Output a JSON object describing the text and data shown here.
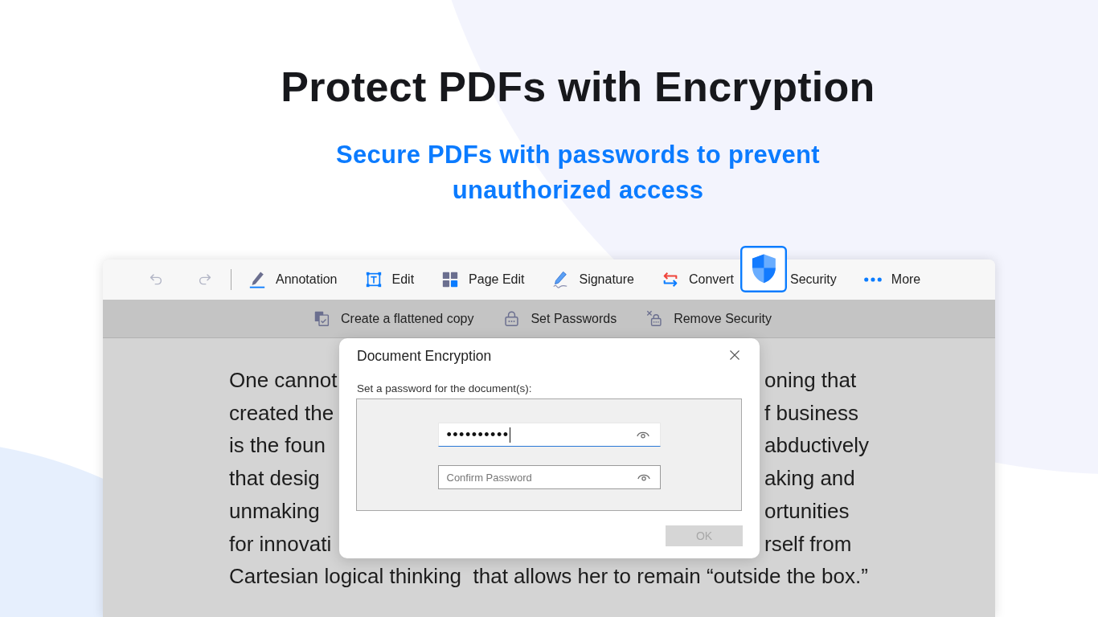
{
  "headline": "Protect PDFs with Encryption",
  "subheadline": "Secure PDFs with passwords to prevent unauthorized access",
  "toolbar": {
    "history": [
      {
        "kind": "undo",
        "disabled": true
      },
      {
        "kind": "redo",
        "disabled": true
      }
    ],
    "tabs": [
      {
        "label": "Annotation",
        "kind": "annotation",
        "selected": false
      },
      {
        "label": "Edit",
        "kind": "edit",
        "selected": false
      },
      {
        "label": "Page Edit",
        "kind": "pageedit",
        "selected": false
      },
      {
        "label": "Signature",
        "kind": "signature",
        "selected": false
      },
      {
        "label": "Convert",
        "kind": "convert",
        "selected": false
      },
      {
        "label": "Security",
        "kind": "security",
        "selected": true
      },
      {
        "label": "More",
        "kind": "more",
        "selected": false
      }
    ]
  },
  "security_toolbar": {
    "items": [
      {
        "label": "Create a flattened copy",
        "kind": "flatten"
      },
      {
        "label": "Set Passwords",
        "kind": "lock"
      },
      {
        "label": "Remove Security",
        "kind": "unlock"
      }
    ]
  },
  "document": {
    "lines": [
      {
        "left": "One cannot",
        "right": "oning that"
      },
      {
        "left": "created the",
        "right": "f business"
      },
      {
        "left": "is the foun",
        "right": "abductively"
      },
      {
        "left": "that desig",
        "right": "aking and"
      },
      {
        "left": "unmaking",
        "right": "ortunities"
      },
      {
        "left": "for innovati",
        "right": "rself from"
      },
      {
        "left": "Cartesian logical thinking  that allows her to remain “outside the box.”"
      }
    ]
  },
  "dialog": {
    "title": "Document Encryption",
    "prompt": "Set a password for the document(s):",
    "password": {
      "value": "••••••••••",
      "focused": true
    },
    "confirm": {
      "placeholder": "Confirm Password",
      "focused": false
    },
    "ok_button": {
      "label": "OK",
      "disabled": true
    }
  }
}
